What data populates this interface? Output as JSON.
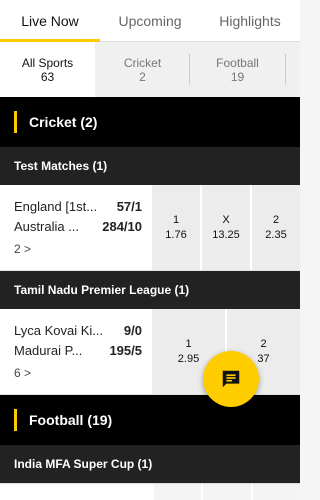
{
  "tabs": [
    {
      "label": "Live Now",
      "active": true
    },
    {
      "label": "Upcoming",
      "active": false
    },
    {
      "label": "Highlights",
      "active": false
    }
  ],
  "filters": [
    {
      "label": "All Sports",
      "count": "63",
      "active": true
    },
    {
      "label": "Cricket",
      "count": "2",
      "active": false
    },
    {
      "label": "Football",
      "count": "19",
      "active": false
    }
  ],
  "sections": {
    "cricket": {
      "title": "Cricket (2)",
      "leagues": [
        {
          "name": "Test Matches (1)",
          "match": {
            "team1": "England [1st...",
            "score1": "57/1",
            "team2": "Australia ...",
            "score2": "284/10",
            "more": "2 >",
            "odds": [
              {
                "label": "1",
                "value": "1.76"
              },
              {
                "label": "X",
                "value": "13.25"
              },
              {
                "label": "2",
                "value": "2.35"
              }
            ]
          }
        },
        {
          "name": "Tamil Nadu Premier League (1)",
          "match": {
            "team1": "Lyca Kovai Ki...",
            "score1": "9/0",
            "team2": "Madurai P...",
            "score2": "195/5",
            "more": "6 >",
            "odds": [
              {
                "label": "1",
                "value": "2.95"
              },
              {
                "label": "2",
                "value": "37"
              }
            ]
          }
        }
      ]
    },
    "football": {
      "title": "Football (19)",
      "league": "India MFA Super Cup (1)"
    }
  },
  "colors": {
    "accent": "#ffcc00",
    "header_bg": "#000000",
    "league_bg": "#222222"
  },
  "icons": {
    "chat": "chat-icon"
  }
}
